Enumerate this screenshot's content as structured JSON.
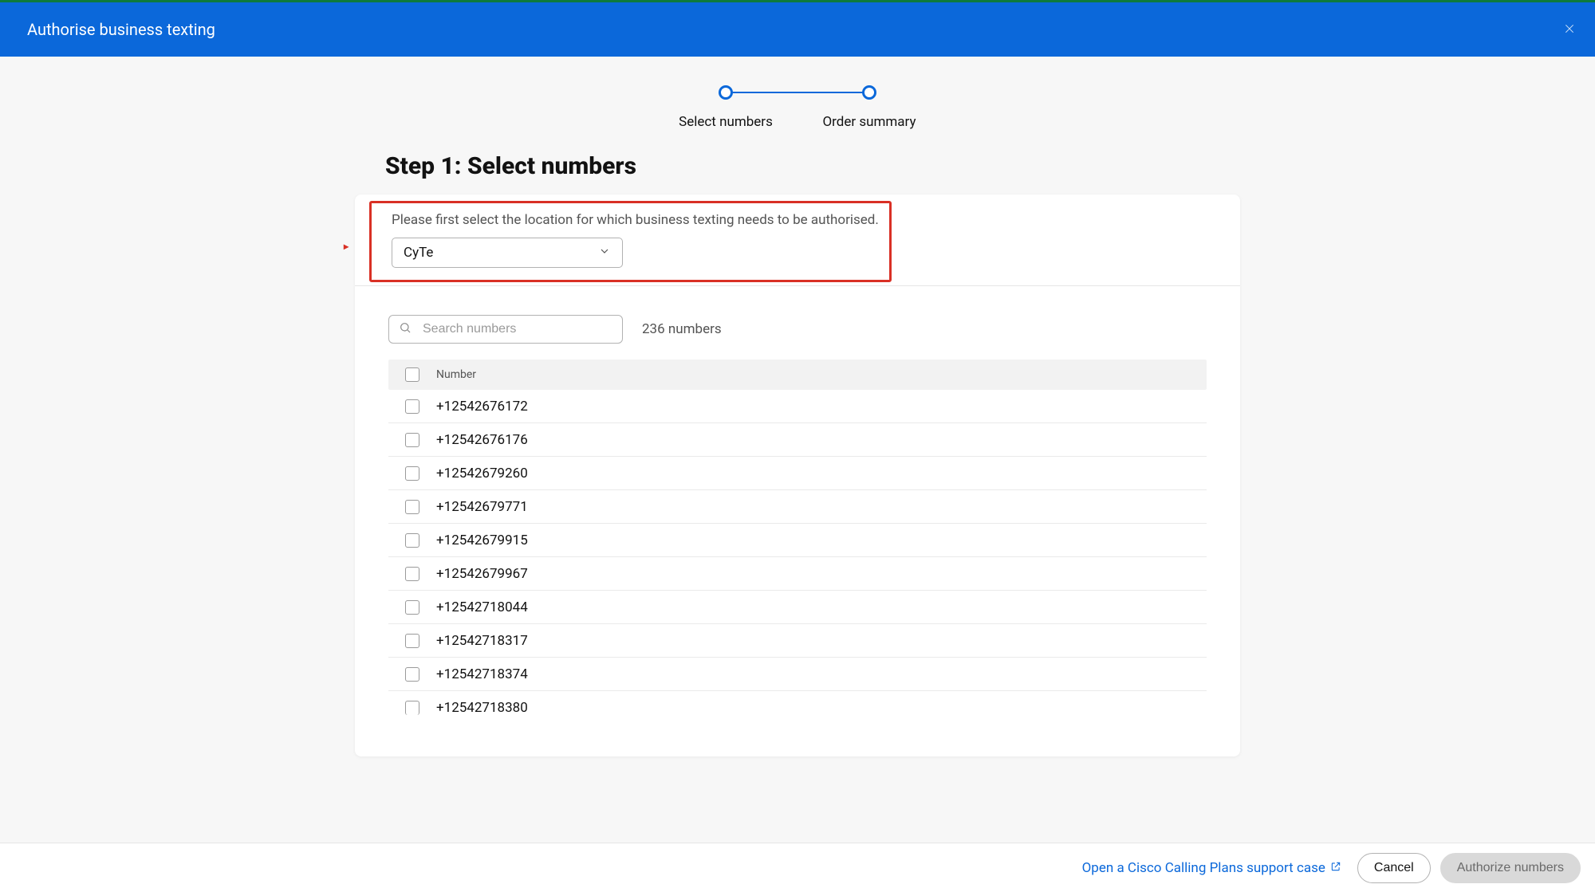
{
  "header": {
    "title": "Authorise business texting"
  },
  "stepper": {
    "steps": [
      {
        "label": "Select numbers"
      },
      {
        "label": "Order summary"
      }
    ]
  },
  "main": {
    "step_title": "Step 1: Select numbers",
    "instruction": "Please first select the location for which business texting needs to be authorised.",
    "location_value": "CyTe",
    "search_placeholder": "Search numbers",
    "count_label": "236 numbers",
    "column_header": "Number",
    "numbers": [
      "+12542676172",
      "+12542676176",
      "+12542679260",
      "+12542679771",
      "+12542679915",
      "+12542679967",
      "+12542718044",
      "+12542718317",
      "+12542718374",
      "+12542718380"
    ]
  },
  "footer": {
    "support_link": "Open a Cisco Calling Plans support case",
    "cancel": "Cancel",
    "authorize": "Authorize numbers"
  }
}
